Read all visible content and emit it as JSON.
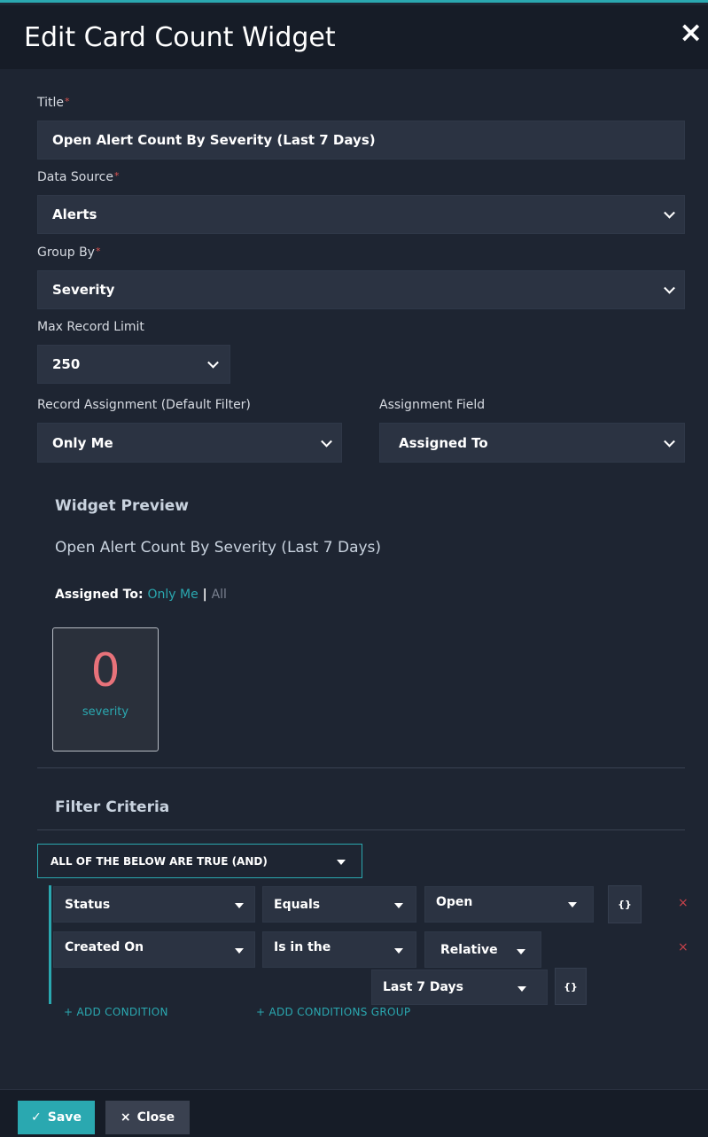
{
  "header": {
    "title": "Edit Card Count Widget",
    "close_icon": "×"
  },
  "form": {
    "title_label": "Title",
    "title_value": "Open Alert Count By Severity (Last 7 Days)",
    "data_source_label": "Data Source",
    "data_source_value": "Alerts",
    "group_by_label": "Group By",
    "group_by_value": "Severity",
    "max_record_label": "Max Record Limit",
    "max_record_value": "250",
    "record_assignment_label": "Record Assignment (Default Filter)",
    "record_assignment_value": "Only Me",
    "assignment_field_label": "Assignment Field",
    "assignment_field_value": "Assigned To",
    "required_marker": "*"
  },
  "preview": {
    "heading": "Widget Preview",
    "title": "Open Alert Count By Severity (Last 7 Days)",
    "assigned_label": "Assigned To:",
    "option_me": "Only Me",
    "separator": "|",
    "option_all": "All",
    "card_count": "0",
    "card_caption": "severity"
  },
  "filter": {
    "heading": "Filter Criteria",
    "logic": "ALL OF THE BELOW ARE TRUE (AND)",
    "conditions": [
      {
        "field": "Status",
        "operator": "Equals",
        "value": "Open"
      },
      {
        "field": "Created On",
        "operator": "Is in the",
        "value": "Relative",
        "sub_value": "Last 7 Days"
      }
    ],
    "brace_label": "{}",
    "delete_icon": "×",
    "add_condition": "+ ADD CONDITION",
    "add_group": "+ ADD CONDITIONS GROUP"
  },
  "footer": {
    "save_label": "Save",
    "save_icon": "✓",
    "close_label": "Close",
    "close_icon": "×"
  },
  "colors": {
    "accent": "#2aa8b0",
    "danger": "#d9534f",
    "count": "#e8727a",
    "background": "#1e2532"
  }
}
